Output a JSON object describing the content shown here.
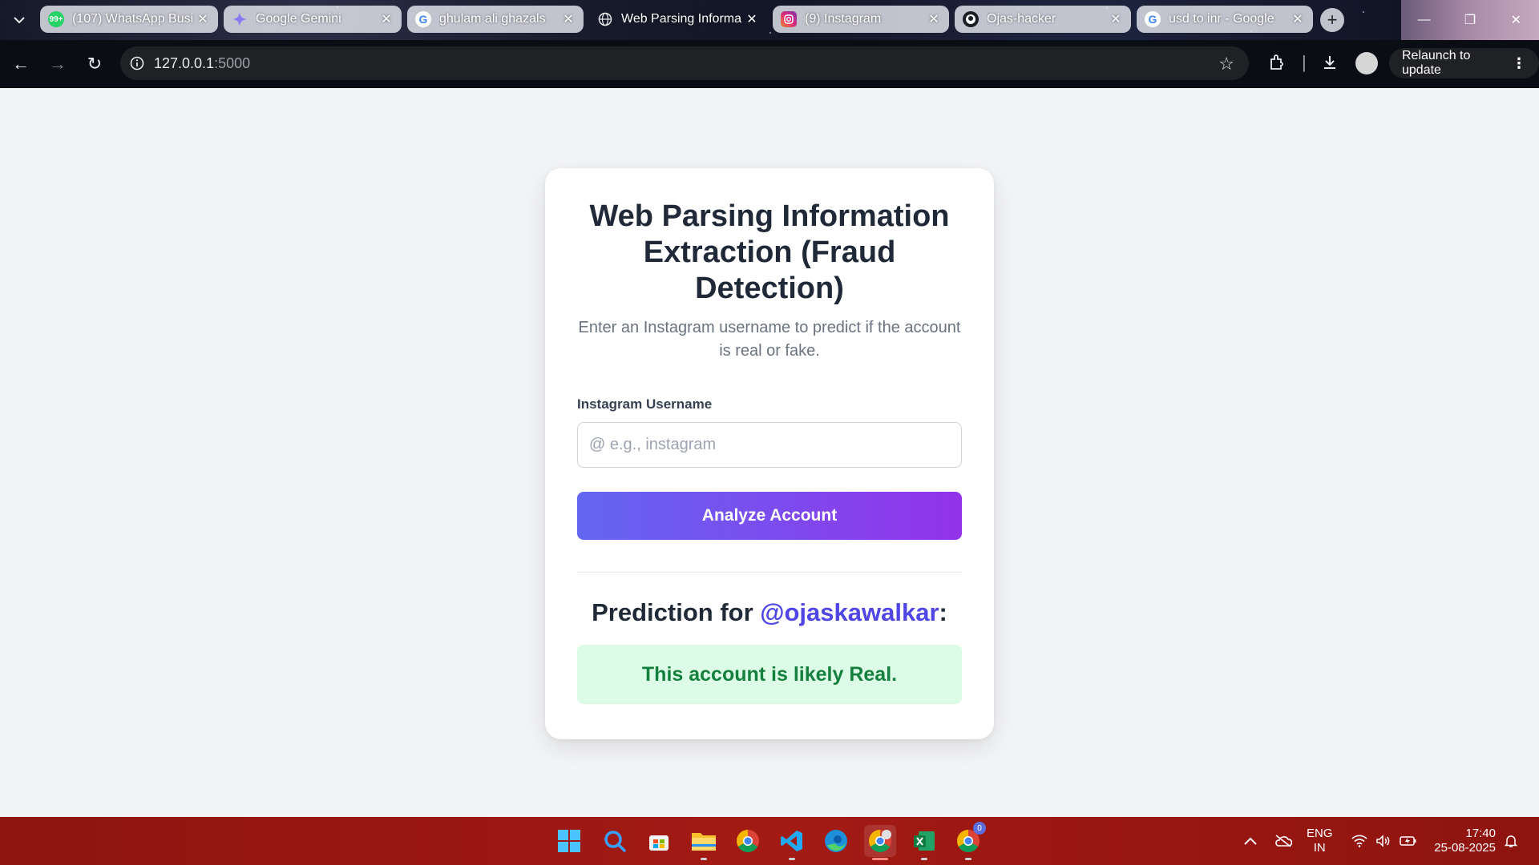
{
  "browser": {
    "tabs": [
      {
        "title": "(107) WhatsApp Busi",
        "favicon": "whatsapp-icon",
        "badge": "99+",
        "active": false
      },
      {
        "title": "Google Gemini",
        "favicon": "gemini-icon",
        "active": false
      },
      {
        "title": "ghulam ali ghazals",
        "favicon": "google-icon",
        "active": false
      },
      {
        "title": "Web Parsing Informa",
        "favicon": "globe-icon",
        "active": true
      },
      {
        "title": "(9) Instagram",
        "favicon": "instagram-icon",
        "active": false
      },
      {
        "title": "Ojas-hacker",
        "favicon": "github-icon",
        "active": false
      },
      {
        "title": "usd to inr - Google",
        "favicon": "google-icon",
        "active": false
      }
    ],
    "url_host": "127.0.0.1",
    "url_port": ":5000",
    "relaunch_label": "Relaunch to update"
  },
  "app": {
    "title": "Web Parsing Information Extraction (Fraud Detection)",
    "subtitle": "Enter an Instagram username to predict if the account is real or fake.",
    "username_label": "Instagram Username",
    "username_placeholder": "@ e.g., instagram",
    "analyze_button": "Analyze Account",
    "prediction_prefix": "Prediction for ",
    "prediction_handle": "@ojaskawalkar",
    "prediction_suffix": ":",
    "result_text": "This account is likely Real."
  },
  "taskbar": {
    "apps": [
      "windows-start-icon",
      "search-icon",
      "store-icon",
      "file-explorer-icon",
      "chrome-icon",
      "vscode-icon",
      "edge-icon",
      "chrome-profile-icon",
      "excel-icon",
      "chrome-canary-icon"
    ],
    "notification_badge": "0",
    "language": "ENG",
    "region": "IN",
    "time": "17:40",
    "date": "25-08-2025"
  },
  "colors": {
    "accent_start": "#6366f1",
    "accent_end": "#9333ea",
    "handle": "#4f46e5",
    "result_bg": "#dcfce7",
    "result_text": "#15803d",
    "taskbar": "#a31a14"
  }
}
